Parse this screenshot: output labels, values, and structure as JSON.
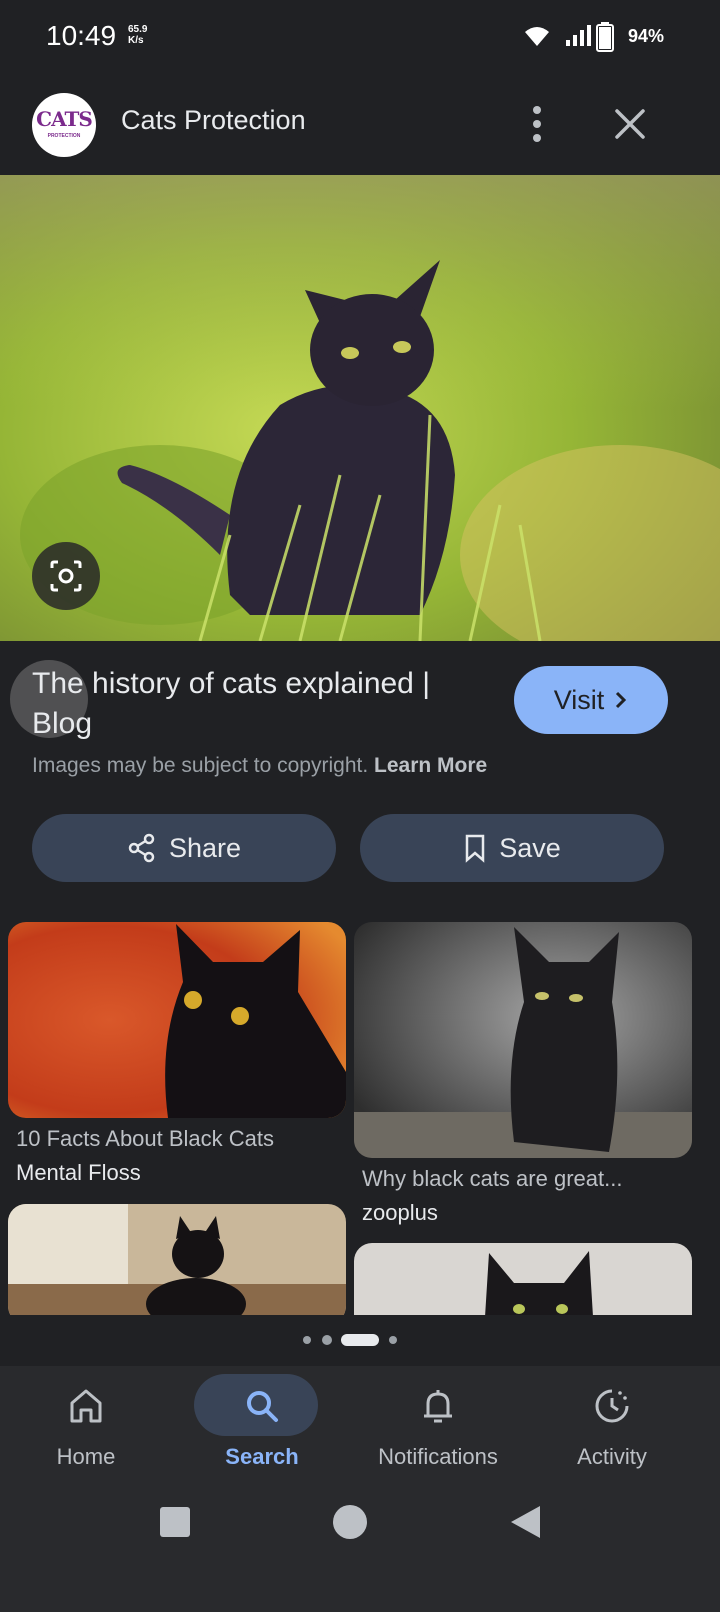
{
  "status_bar": {
    "time": "10:49",
    "net_speed_value": "65.9",
    "net_speed_unit": "K/s",
    "battery": "94%"
  },
  "header": {
    "logo_text": "CATS",
    "logo_subtext": "PROTECTION",
    "site_name": "Cats Protection",
    "menu_icon": "more-vert-icon",
    "close_icon": "close-icon"
  },
  "result": {
    "title": "The history of cats explained | Blog",
    "visit_label": "Visit",
    "copyright_text": "Images may be subject to copyright.",
    "learn_more": "Learn More",
    "share_label": "Share",
    "save_label": "Save"
  },
  "related": [
    {
      "title": "10 Facts About Black Cats",
      "source": "Mental Floss"
    },
    {
      "title": "Why black cats are great...",
      "source": "zooplus"
    }
  ],
  "bottom_nav": {
    "items": [
      {
        "label": "Home",
        "icon": "home-icon"
      },
      {
        "label": "Search",
        "icon": "search-icon"
      },
      {
        "label": "Notifications",
        "icon": "bell-icon"
      },
      {
        "label": "Activity",
        "icon": "activity-icon"
      }
    ],
    "active": "Search"
  },
  "colors": {
    "background": "#202124",
    "accent": "#8ab4f8",
    "pill": "#394457"
  }
}
